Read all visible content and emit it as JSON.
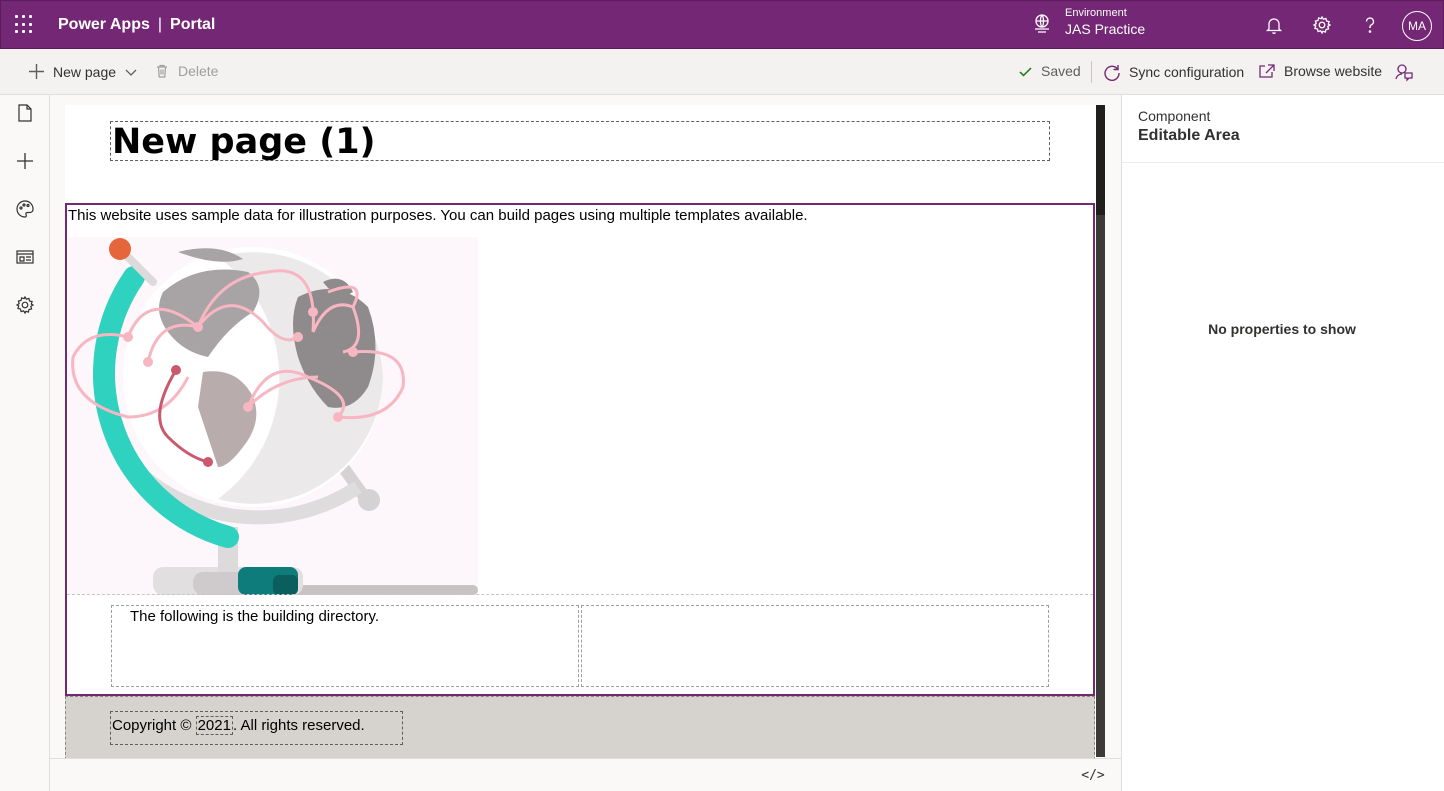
{
  "header": {
    "app_name": "Power Apps",
    "separator": "|",
    "section": "Portal",
    "environment_label": "Environment",
    "environment_name": "JAS Practice",
    "avatar_initials": "MA",
    "bg_color": "#742774"
  },
  "commands": {
    "new_page": "New page",
    "delete": "Delete",
    "saved": "Saved",
    "sync": "Sync configuration",
    "browse": "Browse website"
  },
  "rail": {
    "items": [
      "pages-icon",
      "add-icon",
      "themes-icon",
      "templates-icon",
      "settings-icon"
    ]
  },
  "page": {
    "title": "New page (1)",
    "intro": "This website uses sample data for illustration purposes. You can build pages using multiple templates available.",
    "column_text": "The following is the building directory.",
    "copyright_prefix": "Copyright © ",
    "copyright_year": "2021",
    "copyright_suffix": ". All rights reserved."
  },
  "code_toggle": "</>",
  "panel": {
    "label": "Component",
    "value": "Editable Area",
    "empty_message": "No properties to show"
  }
}
